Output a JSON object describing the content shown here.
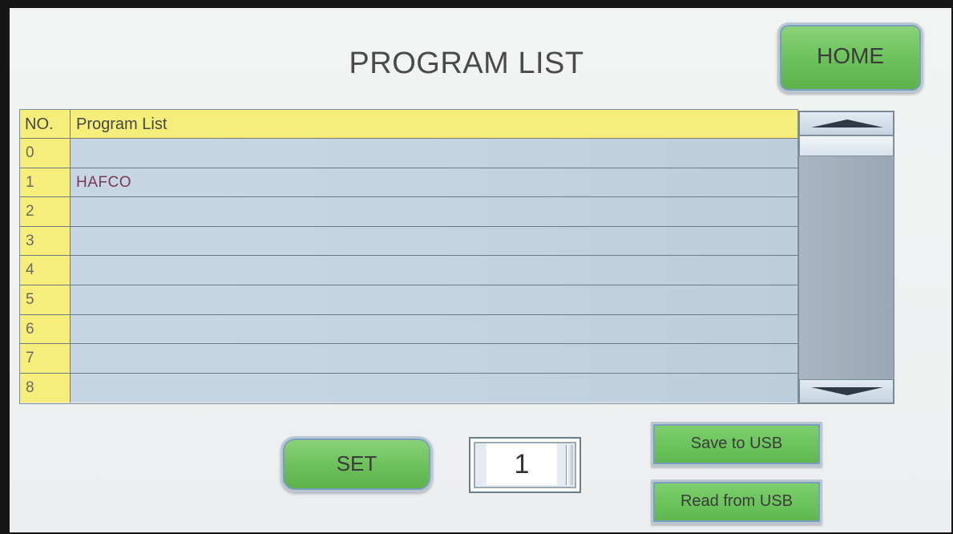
{
  "title": "PROGRAM LIST",
  "home_button": "HOME",
  "table": {
    "header_no": "NO.",
    "header_name": "Program List",
    "rows": [
      {
        "no": "0",
        "name": ""
      },
      {
        "no": "1",
        "name": "HAFCO"
      },
      {
        "no": "2",
        "name": ""
      },
      {
        "no": "3",
        "name": ""
      },
      {
        "no": "4",
        "name": ""
      },
      {
        "no": "5",
        "name": ""
      },
      {
        "no": "6",
        "name": ""
      },
      {
        "no": "7",
        "name": ""
      },
      {
        "no": "8",
        "name": ""
      }
    ]
  },
  "controls": {
    "set_label": "SET",
    "program_number": "1",
    "save_usb_label": "Save to USB",
    "read_usb_label": "Read from USB"
  },
  "colors": {
    "button_green": "#6cc05b",
    "header_yellow": "#f6ee7a",
    "row_blue": "#c4d4e2",
    "program_name_text": "#7a3a52"
  }
}
